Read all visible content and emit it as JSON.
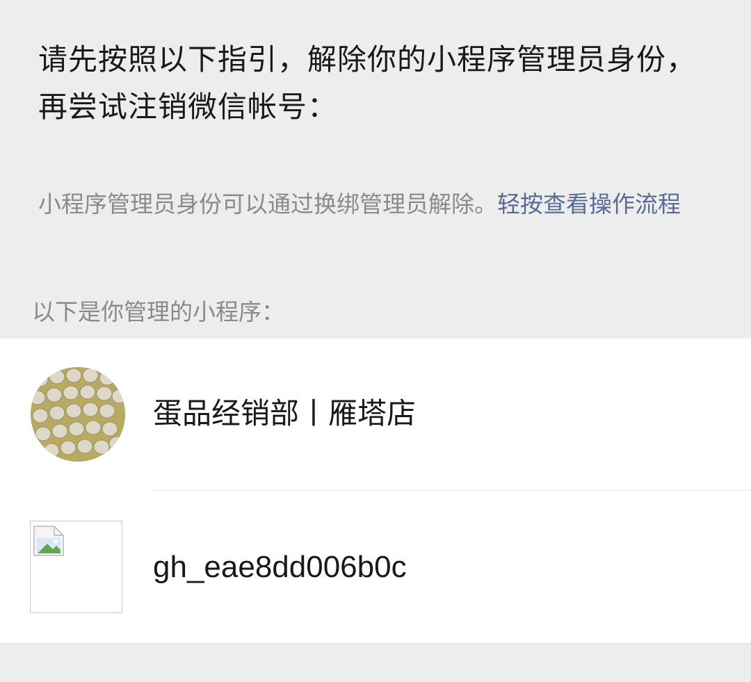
{
  "header": {
    "instruction": "请先按照以下指引，解除你的小程序管理员身份，再尝试注销微信帐号："
  },
  "hint": {
    "text": "小程序管理员身份可以通过换绑管理员解除。",
    "link_label": "轻按查看操作流程"
  },
  "list": {
    "caption": "以下是你管理的小程序：",
    "items": [
      {
        "name": "蛋品经销部丨雁塔店",
        "icon": "eggs-avatar-icon"
      },
      {
        "name": "gh_eae8dd006b0c",
        "icon": "broken-image-icon"
      }
    ]
  },
  "colors": {
    "background": "#ededed",
    "link": "#576b95",
    "secondary_text": "#8a8a8a",
    "primary_text": "#191919"
  }
}
